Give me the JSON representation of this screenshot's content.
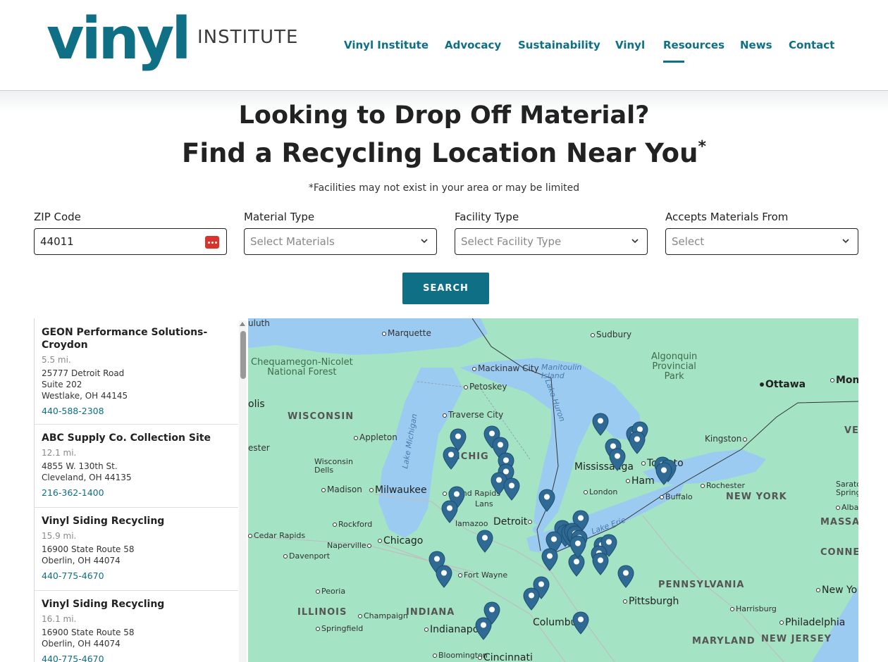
{
  "logo": {
    "brand": "vinyl",
    "sub": "INSTITUTE"
  },
  "nav": [
    {
      "label": "Vinyl Institute"
    },
    {
      "label": "Advocacy"
    },
    {
      "label": "Sustainability"
    },
    {
      "label": "Vinyl"
    },
    {
      "label": "Resources",
      "active": true
    },
    {
      "label": "News"
    },
    {
      "label": "Contact"
    }
  ],
  "hero": {
    "line1": "Looking to Drop Off Material?",
    "line2": "Find a Recycling Location Near You",
    "asterisk": "*",
    "disclaimer": "*Facilities may not exist in your area or may be limited"
  },
  "filters": {
    "zip": {
      "label": "ZIP Code",
      "value": "44011"
    },
    "material": {
      "label": "Material Type",
      "placeholder": "Select Materials"
    },
    "facility": {
      "label": "Facility Type",
      "placeholder": "Select Facility Type"
    },
    "accepts": {
      "label": "Accepts Materials From",
      "placeholder": "Select"
    }
  },
  "search_label": "SEARCH",
  "results": [
    {
      "name": "GEON Performance Solutions-Croydon",
      "distance": "5.5 mi.",
      "address": [
        "25777 Detroit Road",
        "Suite 202",
        "Westlake, OH 44145"
      ],
      "phone": "440-588-2308"
    },
    {
      "name": "ABC Supply Co. Collection Site",
      "distance": "12.1 mi.",
      "address": [
        "4855 W. 130th St.",
        "Cleveland, OH 44135"
      ],
      "phone": "216-362-1400"
    },
    {
      "name": "Vinyl Siding Recycling",
      "distance": "15.9 mi.",
      "address": [
        "16900 State Route 58",
        "Oberlin, OH 44074"
      ],
      "phone": "440-775-4670"
    },
    {
      "name": "Vinyl Siding Recycling",
      "distance": "16.1 mi.",
      "address": [
        "16900 State Route 58",
        "Oberlin, OH 44074"
      ],
      "phone": "440-775-4670"
    }
  ],
  "map": {
    "colors": {
      "land": "#a4e3c4",
      "water": "#9ccbf2",
      "pin": "#2e6a93"
    },
    "labels": {
      "duluth": "uluth",
      "marquette": "Marquette",
      "sudbury": "Sudbury",
      "chequamegon": "Chequamegon-Nicolet",
      "chequamegon2": "National Forest",
      "mackinaw": "Mackinaw City",
      "manitoulin": "Manitoulin",
      "manitoulin2": "Island",
      "algonquin": "Algonquin",
      "algonquin2": "Provincial",
      "algonquin3": "Park",
      "ottawa": "Ottawa",
      "mont": "Mont",
      "petoskey": "Petoskey",
      "lake_huron": "Lake Huron",
      "lake_michigan": "Lake Michigan",
      "lake_erie": "Lake Erie",
      "wisconsin": "WISCONSIN",
      "olis": "olis",
      "traverse": "Traverse City",
      "verm": "VERM",
      "kingston": "Kingston",
      "appleton": "Appleton",
      "ester": "ester",
      "michigan": "MICHIG",
      "wisdells": "Wisconsin",
      "wisdells2": "Dells",
      "mississauga": "Mississauga",
      "toronto": "Toronto",
      "hamilton": "Ham",
      "madison": "Madison",
      "milwaukee": "Milwaukee",
      "grandrapids": "Grand Rapids",
      "london": "London",
      "rochester": "Rochester",
      "saratoga": "Saratoga",
      "saratoga2": "Springs",
      "lansing": "Lans",
      "buffalo": "Buffalo",
      "newyork": "NEW YORK",
      "albany": "Albany",
      "rockford": "Rockford",
      "kalamazoo": "lamazoo",
      "detroit": "Detroit",
      "massa": "MASSA",
      "cedarrapids": "Cedar Rapids",
      "naperville": "Naperville",
      "chicago": "Chicago",
      "davenport": "Davenport",
      "conne": "CONNE",
      "fortwayne": "Fort Wayne",
      "peoria": "Peoria",
      "pennsylvania": "PENNSYLVANIA",
      "newyork_city": "New Yo",
      "illinois": "ILLINOIS",
      "indiana": "INDIANA",
      "champaign": "Champaign",
      "columbus": "Columbus",
      "pittsburgh": "Pittsburgh",
      "harrisburg": "Harrisburg",
      "springfield": "Springfield",
      "indianapolis": "Indianapoli",
      "philadelphia": "Philadelphia",
      "maryland": "MARYLAND",
      "newjersey": "NEW JERSEY",
      "bloomington": "Bloomington",
      "cincinnati": "Cincinnati"
    }
  }
}
